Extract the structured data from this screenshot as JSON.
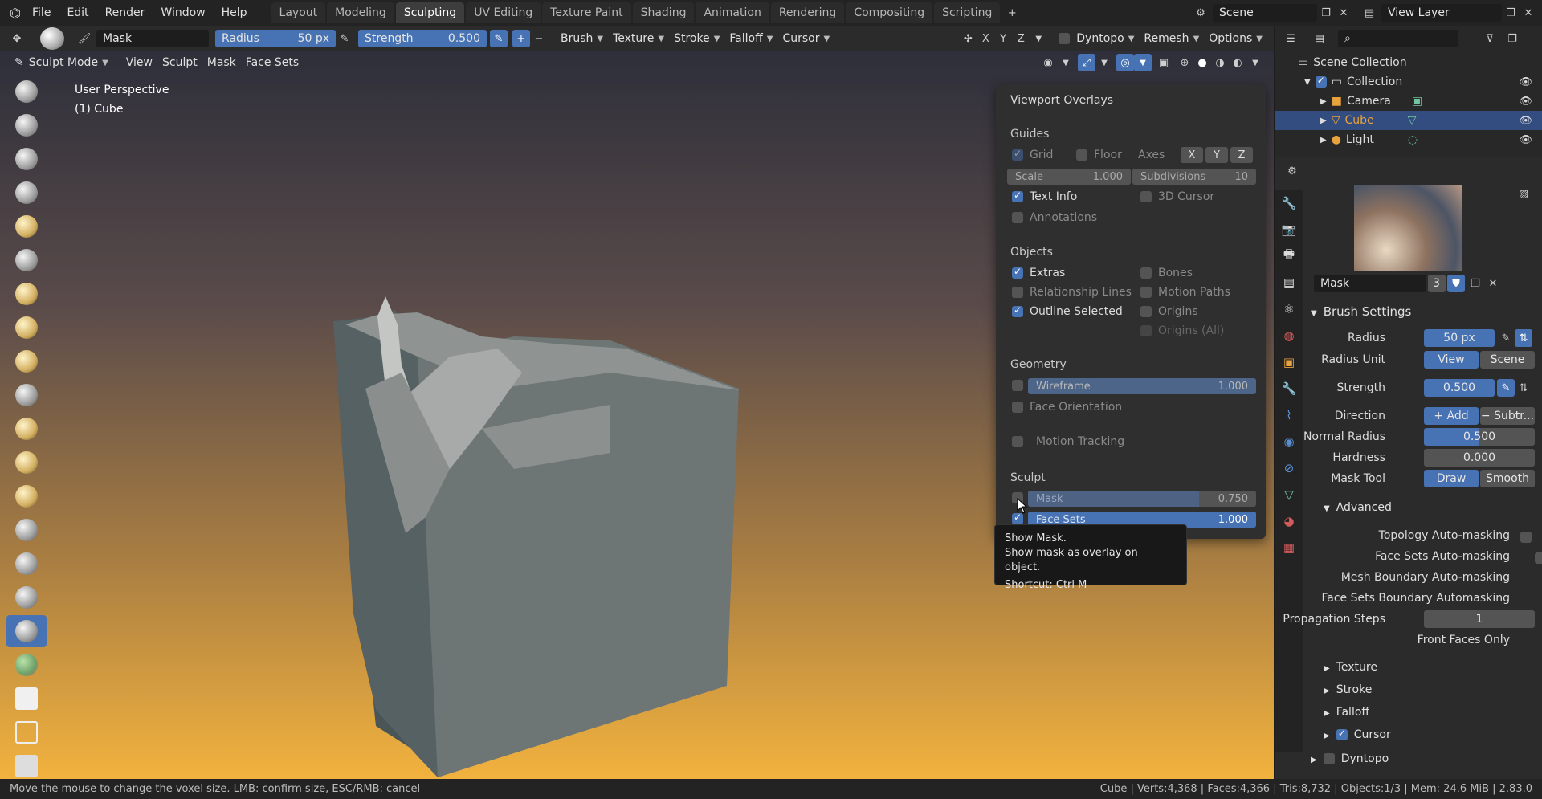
{
  "topbar": {
    "menus": [
      "File",
      "Edit",
      "Render",
      "Window",
      "Help"
    ],
    "tabs": [
      "Layout",
      "Modeling",
      "Sculpting",
      "UV Editing",
      "Texture Paint",
      "Shading",
      "Animation",
      "Rendering",
      "Compositing",
      "Scripting"
    ],
    "active_tab": "Sculpting",
    "scene": "Scene",
    "view_layer": "View Layer",
    "add_tab": "+"
  },
  "tool_header": {
    "brush_name": "Mask",
    "radius_label": "Radius",
    "radius_value": "50 px",
    "strength_label": "Strength",
    "strength_value": "0.500",
    "brush": "Brush",
    "texture": "Texture",
    "stroke": "Stroke",
    "falloff": "Falloff",
    "cursor": "Cursor",
    "x": "X",
    "y": "Y",
    "z": "Z",
    "dyntopo": "Dyntopo",
    "remesh": "Remesh",
    "options": "Options"
  },
  "view_header": {
    "mode": "Sculpt Mode",
    "menus": [
      "View",
      "Sculpt",
      "Mask",
      "Face Sets"
    ]
  },
  "viewport": {
    "perspective": "User Perspective",
    "object": "(1) Cube"
  },
  "overlays": {
    "title": "Viewport Overlays",
    "guides": "Guides",
    "grid": "Grid",
    "floor": "Floor",
    "axes": "Axes",
    "ax_x": "X",
    "ax_y": "Y",
    "ax_z": "Z",
    "scale_label": "Scale",
    "scale_value": "1.000",
    "subdiv_label": "Subdivisions",
    "subdiv_value": "10",
    "text_info": "Text Info",
    "cursor3d": "3D Cursor",
    "annotations": "Annotations",
    "objects": "Objects",
    "extras": "Extras",
    "bones": "Bones",
    "relationship": "Relationship Lines",
    "motion_paths": "Motion Paths",
    "outline": "Outline Selected",
    "origins": "Origins",
    "origins_all": "Origins (All)",
    "geometry": "Geometry",
    "wireframe": "Wireframe",
    "wireframe_value": "1.000",
    "wireframe_fill": 1.0,
    "face_orientation": "Face Orientation",
    "motion_tracking": "Motion Tracking",
    "sculpt": "Sculpt",
    "mask": "Mask",
    "mask_value": "0.750",
    "mask_fill": 0.75,
    "face_sets": "Face Sets",
    "face_sets_value": "1.000",
    "face_sets_fill": 1.0
  },
  "tooltip": {
    "line1": "Show Mask.",
    "line2": "Show mask as overlay on object.",
    "line3": "Shortcut: Ctrl M"
  },
  "outliner": {
    "root": "Scene Collection",
    "collection": "Collection",
    "items": [
      "Camera",
      "Cube",
      "Light"
    ],
    "selected": "Cube"
  },
  "properties": {
    "brush_name": "Mask",
    "users": "3",
    "brush_settings": "Brush Settings",
    "radius_label": "Radius",
    "radius_value": "50 px",
    "radius_unit_label": "Radius Unit",
    "unit_view": "View",
    "unit_scene": "Scene",
    "strength_label": "Strength",
    "strength_value": "0.500",
    "direction_label": "Direction",
    "dir_add": "+ Add",
    "dir_sub": "− Subtr...",
    "normal_radius_label": "Normal Radius",
    "normal_radius_value": "0.500",
    "hardness_label": "Hardness",
    "hardness_value": "0.000",
    "mask_tool_label": "Mask Tool",
    "mask_draw": "Draw",
    "mask_smooth": "Smooth",
    "advanced": "Advanced",
    "topology": "Topology Auto-masking",
    "facesets_auto": "Face Sets Auto-masking",
    "mesh_boundary": "Mesh Boundary Auto-masking",
    "facesets_boundary": "Face Sets Boundary Automasking",
    "propagation_label": "Propagation Steps",
    "propagation_value": "1",
    "front_faces": "Front Faces Only",
    "texture": "Texture",
    "stroke": "Stroke",
    "falloff": "Falloff",
    "cursor": "Cursor",
    "dyntopo": "Dyntopo"
  },
  "status": {
    "left": "Move the mouse to change the voxel size. LMB: confirm size, ESC/RMB: cancel",
    "right": "Cube | Verts:4,368 | Faces:4,366 | Tris:8,732 | Objects:1/3 | Mem: 24.6 MiB | 2.83.0"
  },
  "colors": {
    "accent": "#4772b3",
    "selected_row": "#334d80",
    "cube_orange": "#e8a33d"
  }
}
